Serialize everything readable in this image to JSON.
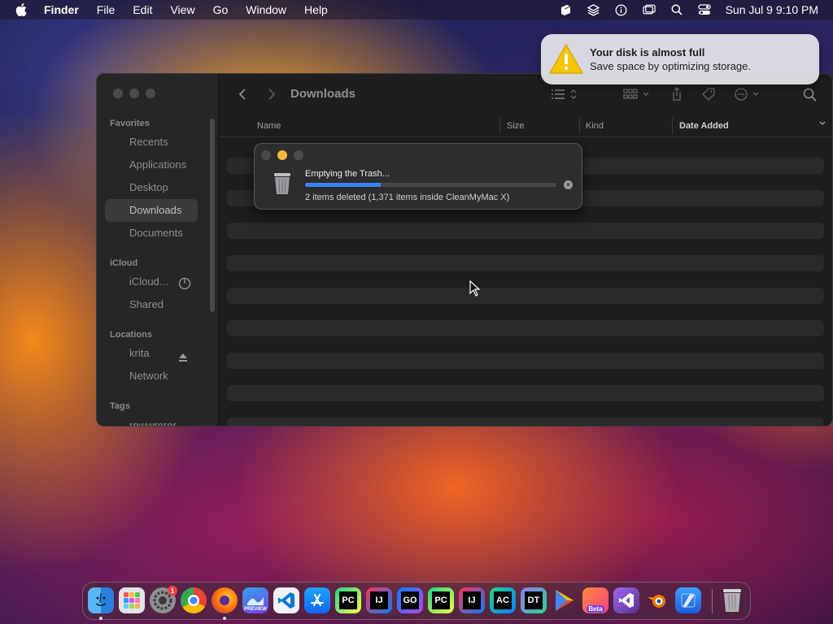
{
  "menubar": {
    "items": [
      "Finder",
      "File",
      "Edit",
      "View",
      "Go",
      "Window",
      "Help"
    ],
    "clock": "Sun Jul 9  9:10 PM"
  },
  "notification": {
    "title": "Your disk is almost full",
    "body": "Save space by optimizing storage."
  },
  "finder": {
    "title": "Downloads",
    "sidebar": {
      "favorites_header": "Favorites",
      "favorites": [
        "Recents",
        "Applications",
        "Desktop",
        "Downloads",
        "Documents"
      ],
      "icloud_header": "iCloud",
      "icloud": [
        "iCloud...",
        "Shared"
      ],
      "locations_header": "Locations",
      "locations": [
        "krita",
        "Network"
      ],
      "tags_header": "Tags",
      "tags": [
        "rewwrerer"
      ]
    },
    "columns": {
      "name": "Name",
      "size": "Size",
      "kind": "Kind",
      "date_added": "Date Added"
    }
  },
  "trash_dialog": {
    "title": "Emptying the Trash...",
    "progress": 0.3,
    "status": "2 items deleted (1,371 items inside CleanMyMac X)"
  },
  "dock": {
    "labels": {
      "pycharm": "PC",
      "intellij": "IJ",
      "goland": "GO",
      "pycharm2": "PC",
      "intellij2": "IJ",
      "appcode": "AC",
      "datagrip": "DT",
      "beta": "Beta",
      "preview": "PREVIEW",
      "settings_badge": "1"
    }
  },
  "colors": {
    "accent_blue": "#3b82f6",
    "warning_yellow": "#f5c400",
    "minimize_yellow": "#f6b73c"
  }
}
